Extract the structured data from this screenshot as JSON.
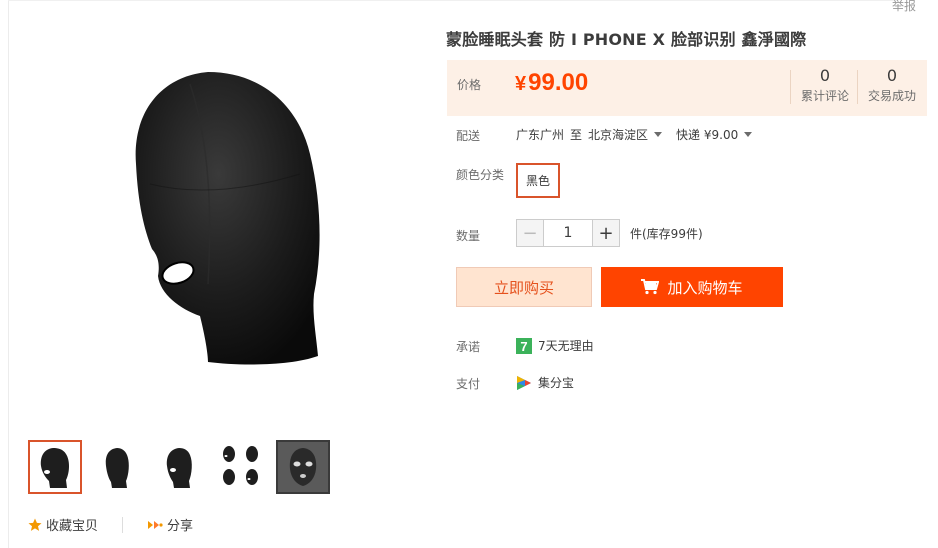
{
  "report": "举报",
  "product": {
    "title": "蒙脸睡眠头套 防 I PHONE X 脸部识别 鑫淨國際"
  },
  "price": {
    "label": "价格",
    "currency": "¥",
    "value": "99.00",
    "reviews_count": "0",
    "reviews_label": "累计评论",
    "sales_count": "0",
    "sales_label": "交易成功"
  },
  "shipping": {
    "label": "配送",
    "from": "广东广州",
    "to_word": "至",
    "to": "北京海淀区",
    "method": "快递 ¥9.00"
  },
  "color": {
    "label": "颜色分类",
    "selected": "黑色"
  },
  "quantity": {
    "label": "数量",
    "minus": "−",
    "value": "1",
    "plus": "+",
    "unit": "件(库存99件)"
  },
  "buttons": {
    "buy_now": "立即购买",
    "add_to_cart": "加入购物车"
  },
  "promise": {
    "label": "承诺",
    "text": "7天无理由",
    "badge": "7"
  },
  "payment": {
    "label": "支付",
    "text": "集分宝"
  },
  "actions": {
    "favorite": "收藏宝贝",
    "share": "分享"
  },
  "colors": {
    "accent": "#ff4400",
    "accent_dark": "#d9542b",
    "price_bg": "#fdf0e6",
    "buy_bg": "#ffe4d0",
    "text": "#3c3c3c",
    "muted": "#6c6c6c"
  },
  "icons": {
    "cart": "cart-icon",
    "star": "star-icon",
    "share": "share-icon",
    "promise": "seven-day-badge-icon",
    "payment": "jifenbao-icon"
  }
}
